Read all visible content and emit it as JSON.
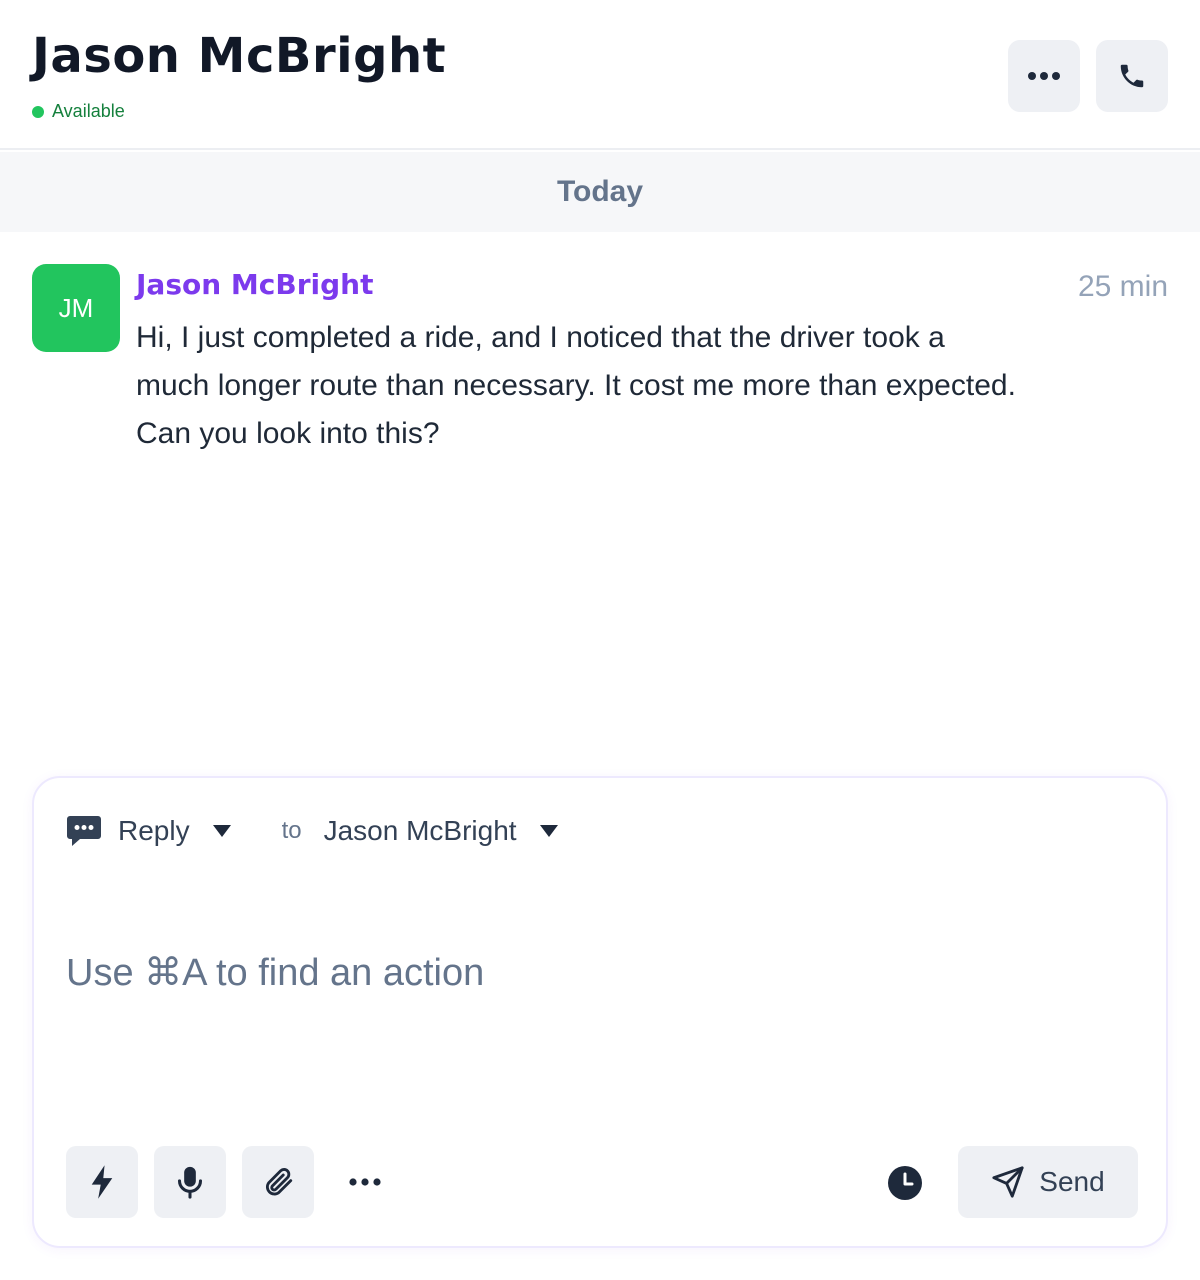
{
  "header": {
    "contact_name": "Jason McBright",
    "status": "Available",
    "status_color": "#22c55e",
    "more_icon": "more-horizontal-icon",
    "call_icon": "phone-icon"
  },
  "conversation": {
    "day_label": "Today",
    "messages": [
      {
        "avatar_initials": "JM",
        "avatar_color": "#22c55e",
        "sender": "Jason McBright",
        "sender_color": "#7c3aed",
        "time": "25 min",
        "body": "Hi, I just completed a ride, and I noticed that the driver took a much longer route than necessary. It cost me more than expected. Can you look into this?"
      }
    ]
  },
  "composer": {
    "mode_label": "Reply",
    "to_label": "to",
    "recipient": "Jason McBright",
    "placeholder": "Use ⌘A to find an action",
    "send_label": "Send",
    "tools": [
      "bolt-icon",
      "microphone-icon",
      "paperclip-icon",
      "more-horizontal-icon",
      "clock-icon",
      "send-icon"
    ]
  }
}
